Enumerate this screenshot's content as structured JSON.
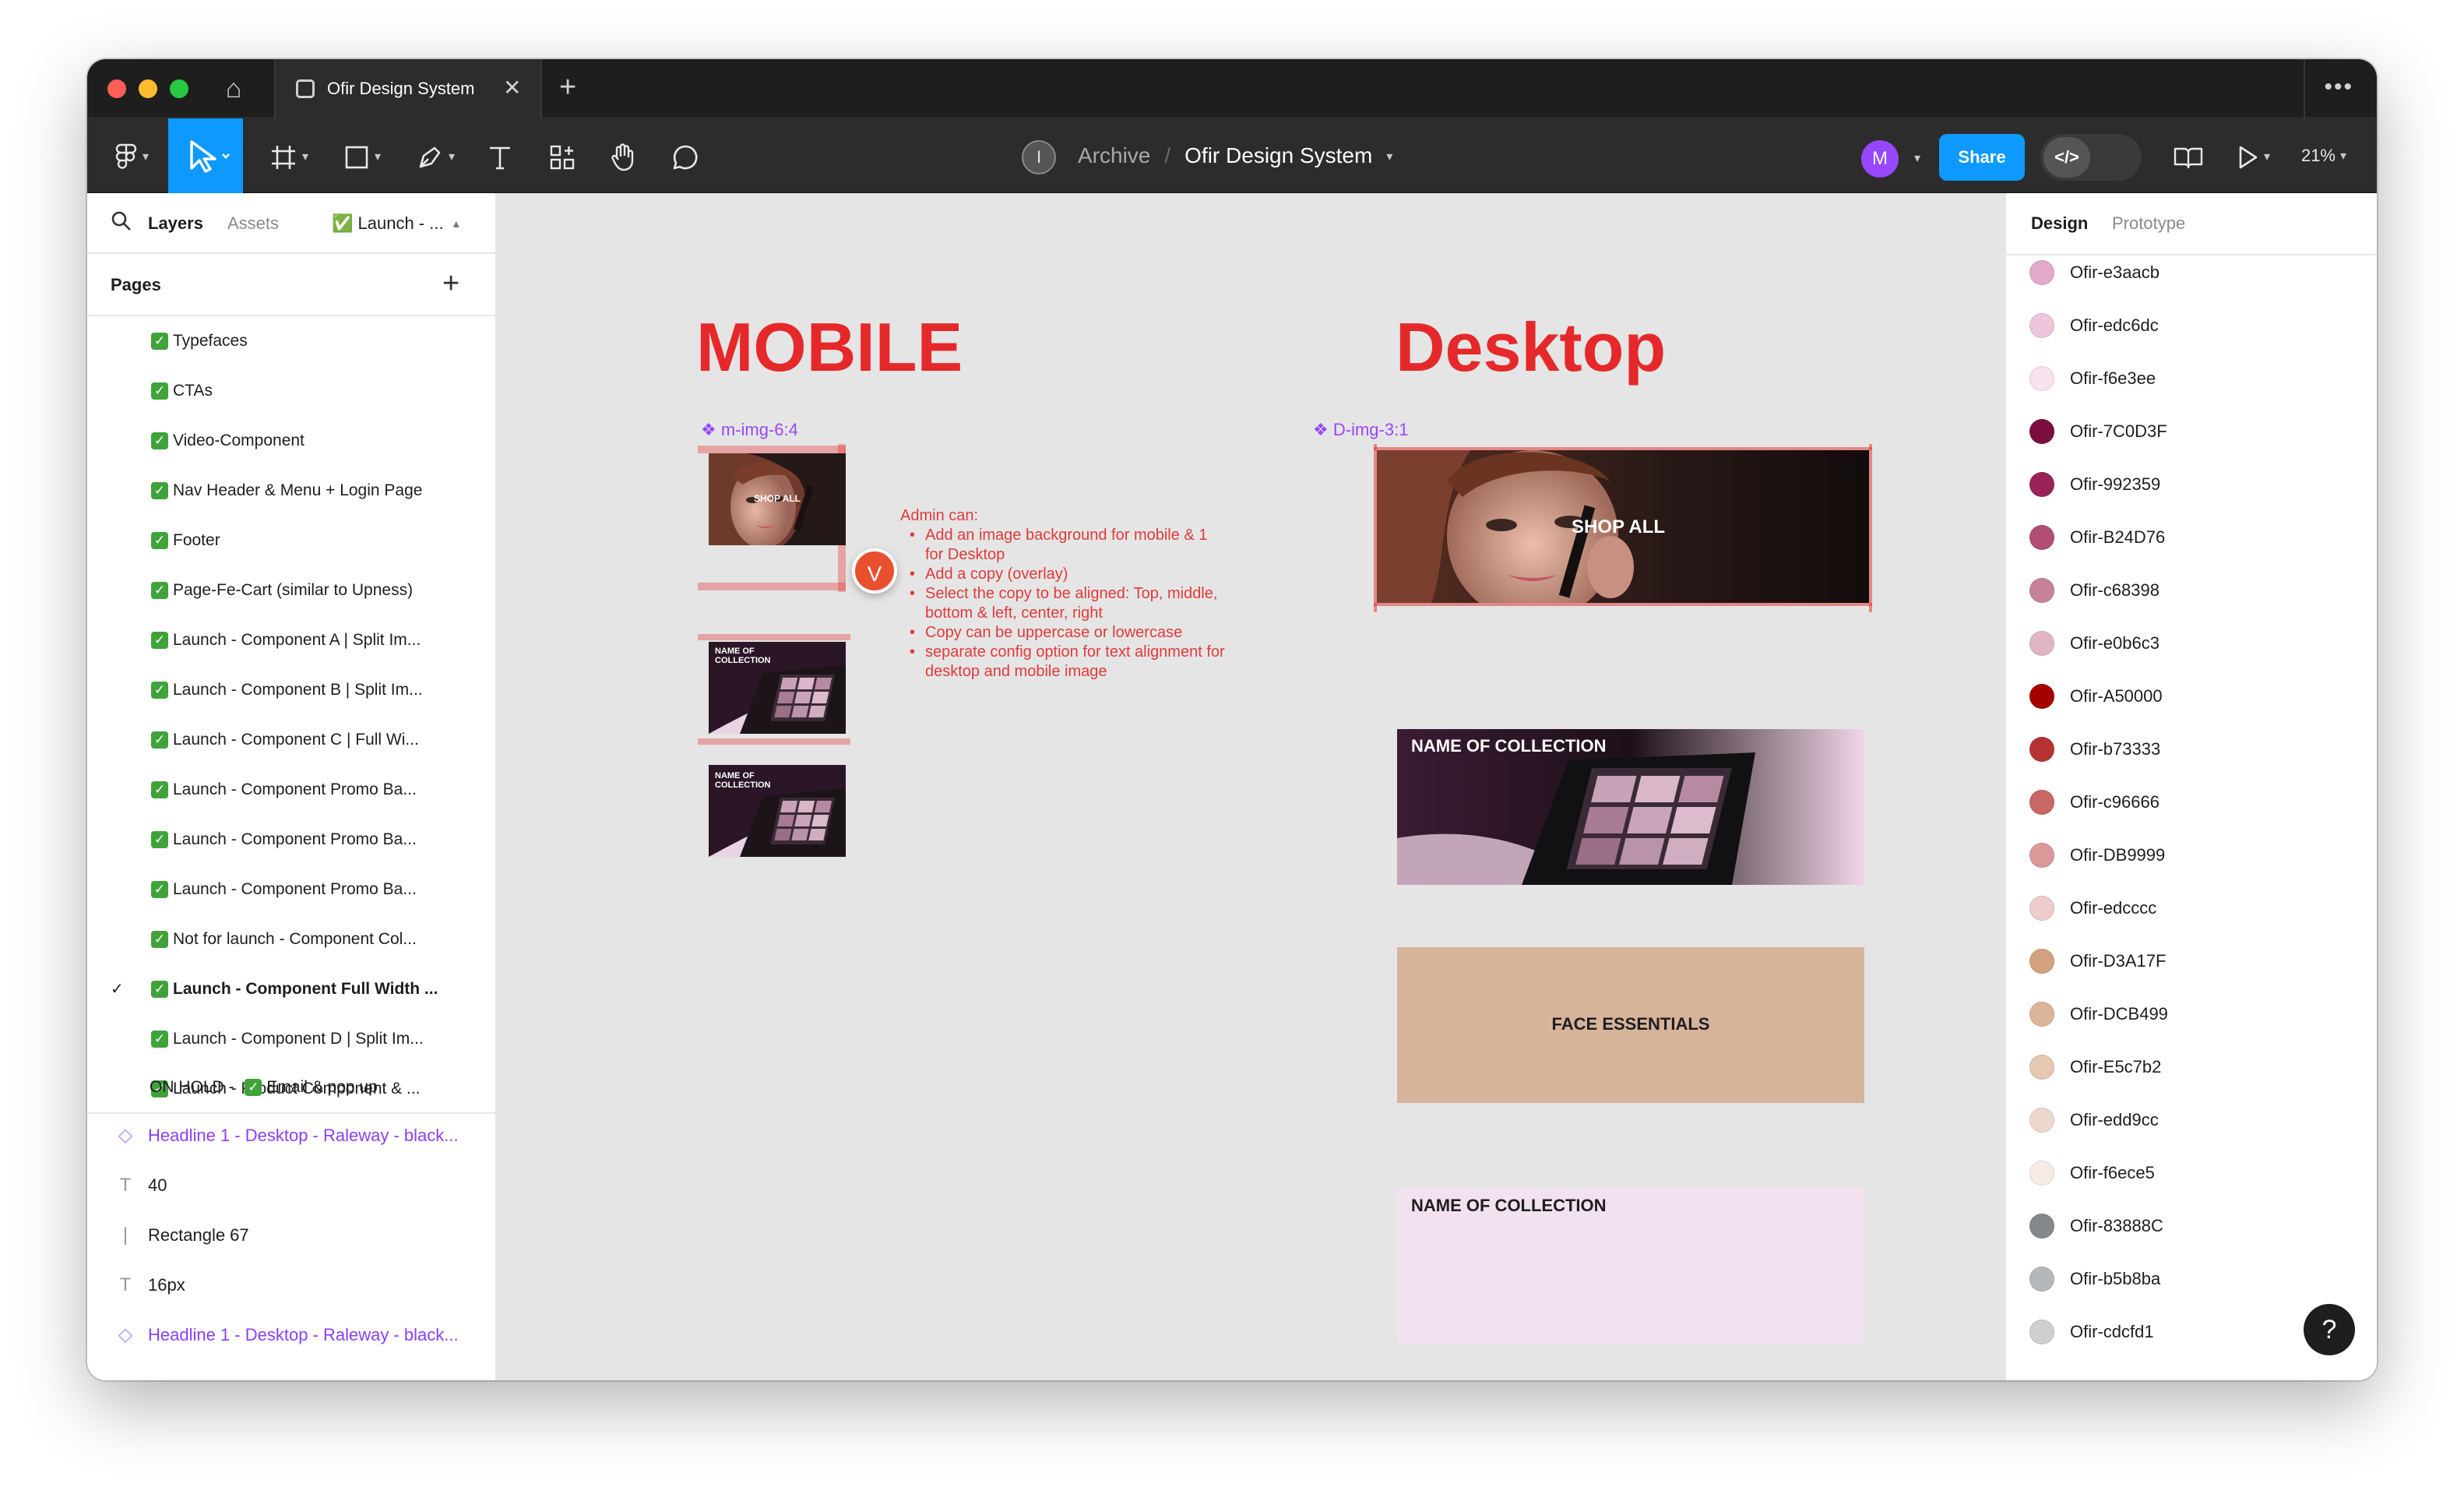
{
  "window": {
    "tab_title": "Ofir Design System",
    "new_tab_glyph": "+",
    "close_glyph": "✕",
    "more_glyph": "•••"
  },
  "toolbar": {
    "breadcrumb_team_initial": "I",
    "breadcrumb_parent": "Archive",
    "breadcrumb_sep": "/",
    "breadcrumb_file": "Ofir Design System",
    "avatar_initial": "M",
    "share_label": "Share",
    "dev_mode_label": "</>",
    "zoom_label": "21%"
  },
  "left_panel": {
    "tab_layers": "Layers",
    "tab_assets": "Assets",
    "current_page_short": "✅ Launch - ...",
    "pages_header": "Pages",
    "add_page_glyph": "+",
    "pages": [
      {
        "label": "Typefaces",
        "selected": false
      },
      {
        "label": "CTAs",
        "selected": false
      },
      {
        "label": "Video-Component",
        "selected": false
      },
      {
        "label": "Nav Header & Menu + Login Page",
        "selected": false
      },
      {
        "label": "Footer",
        "selected": false
      },
      {
        "label": "Page-Fe-Cart (similar to Upness)",
        "selected": false
      },
      {
        "label": "Launch - Component A | Split Im...",
        "selected": false
      },
      {
        "label": "Launch - Component B | Split Im...",
        "selected": false
      },
      {
        "label": "Launch - Component C | Full Wi...",
        "selected": false
      },
      {
        "label": "Launch - Component Promo Ba...",
        "selected": false
      },
      {
        "label": "Launch - Component Promo Ba...",
        "selected": false
      },
      {
        "label": "Launch - Component Promo Ba...",
        "selected": false
      },
      {
        "label": "Not for launch - Component Col...",
        "selected": false
      },
      {
        "label": "Launch - Component Full Width ...",
        "selected": true
      },
      {
        "label": "Launch - Component D | Split Im...",
        "selected": false
      },
      {
        "label": "Launch - Product Component & ...",
        "selected": false
      }
    ],
    "on_hold_prefix": "ON HOLD -",
    "on_hold_label": "Email & pop up",
    "layers": [
      {
        "icon": "◇",
        "label": "Headline 1 - Desktop - Raleway - black...",
        "kind": "component"
      },
      {
        "icon": "T",
        "label": "40",
        "kind": "text"
      },
      {
        "icon": "|",
        "label": "Rectangle 67",
        "kind": "rect"
      },
      {
        "icon": "T",
        "label": "16px",
        "kind": "text"
      },
      {
        "icon": "◇",
        "label": "Headline 1 - Desktop - Raleway - black...",
        "kind": "component"
      }
    ]
  },
  "right_panel": {
    "tab_design": "Design",
    "tab_prototype": "Prototype",
    "swatches": [
      {
        "name": "Ofir-e3aacb",
        "color": "#e3aacb"
      },
      {
        "name": "Ofir-edc6dc",
        "color": "#edc6dc"
      },
      {
        "name": "Ofir-f6e3ee",
        "color": "#f6e3ee"
      },
      {
        "name": "Ofir-7C0D3F",
        "color": "#7C0D3F"
      },
      {
        "name": "Ofir-992359",
        "color": "#992359"
      },
      {
        "name": "Ofir-B24D76",
        "color": "#B24D76"
      },
      {
        "name": "Ofir-c68398",
        "color": "#c68398"
      },
      {
        "name": "Ofir-e0b6c3",
        "color": "#e0b6c3"
      },
      {
        "name": "Ofir-A50000",
        "color": "#A50000"
      },
      {
        "name": "Ofir-b73333",
        "color": "#b73333"
      },
      {
        "name": "Ofir-c96666",
        "color": "#c96666"
      },
      {
        "name": "Ofir-DB9999",
        "color": "#DB9999"
      },
      {
        "name": "Ofir-edcccc",
        "color": "#edcccc"
      },
      {
        "name": "Ofir-D3A17F",
        "color": "#D3A17F"
      },
      {
        "name": "Ofir-DCB499",
        "color": "#DCB499"
      },
      {
        "name": "Ofir-E5c7b2",
        "color": "#E5c7b2"
      },
      {
        "name": "Ofir-edd9cc",
        "color": "#edd9cc"
      },
      {
        "name": "Ofir-f6ece5",
        "color": "#f6ece5"
      },
      {
        "name": "Ofir-83888C",
        "color": "#83888C"
      },
      {
        "name": "Ofir-b5b8ba",
        "color": "#b5b8ba"
      },
      {
        "name": "Ofir-cdcfd1",
        "color": "#cdcfd1"
      }
    ],
    "help_glyph": "?"
  },
  "canvas": {
    "mobile_title": "MOBILE",
    "desktop_title": "Desktop",
    "mobile_frame_label": "m-img-6:4",
    "desktop_frame_label": "D-img-3:1",
    "shop_all": "SHOP ALL",
    "name_of_collection": "NAME OF COLLECTION",
    "mobile_collection_line1": "NAME OF",
    "mobile_collection_line2": "COLLECTION",
    "face_essentials": "FACE ESSENTIALS",
    "comment_initial": "V",
    "admin_heading": "Admin can:",
    "admin_points": [
      "Add an image background for mobile & 1 for Desktop",
      "Add a copy (overlay)",
      "Select the copy to be aligned: Top, middle, bottom & left, center, right",
      "Copy can be uppercase or lowercase",
      "separate config option for text alignment for desktop and mobile image"
    ]
  }
}
